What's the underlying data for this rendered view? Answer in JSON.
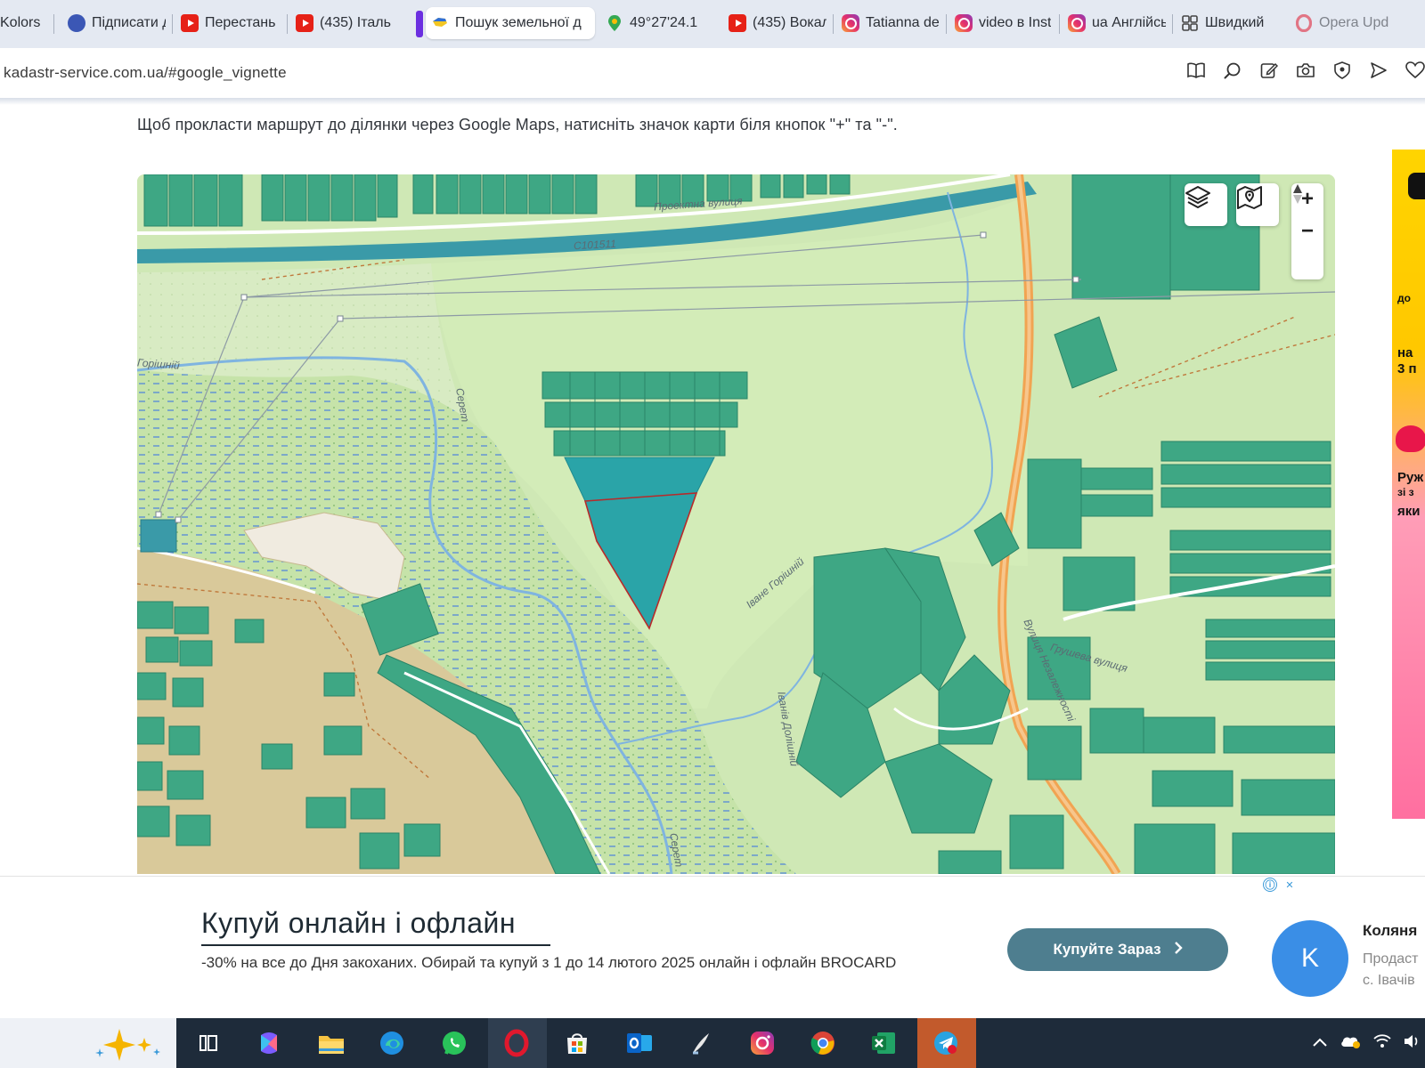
{
  "browser": {
    "tabs": [
      {
        "title": "Kolors",
        "icon": "kolors-icon"
      },
      {
        "title": "Підписати д",
        "icon": "globe-icon"
      },
      {
        "title": "Перестань",
        "icon": "youtube-icon"
      },
      {
        "title": "(435) Італь",
        "icon": "youtube-icon"
      },
      {
        "title": "Пошук земельної д",
        "icon": "ukraine-map-icon",
        "active": true
      },
      {
        "title": "49°27'24.1",
        "icon": "google-maps-pin-icon"
      },
      {
        "title": "(435) Вокал",
        "icon": "youtube-icon"
      },
      {
        "title": "Tatianna de",
        "icon": "instagram-icon"
      },
      {
        "title": "video в Inst",
        "icon": "instagram-icon"
      },
      {
        "title": "ua Англійсь",
        "icon": "instagram-icon"
      },
      {
        "title": "Швидкий",
        "icon": "speed-dial-icon"
      },
      {
        "title": "Opera Upd",
        "icon": "opera-icon"
      }
    ],
    "url": "kadastr-service.com.ua/#google_vignette",
    "toolbar_icons": [
      "reader-icon",
      "search-icon",
      "edit-icon",
      "camera-icon",
      "shield-icon",
      "send-icon",
      "heart-icon"
    ]
  },
  "page": {
    "instruction": "Щоб прокласти маршрут до ділянки через Google Maps, натисніть значок карти біля кнопок \"+\" та \"-\"."
  },
  "map": {
    "controls": {
      "layers": "layers-icon",
      "maps_route": "map-route-icon",
      "zoom_in": "+",
      "zoom_out": "−",
      "compass": "compass-icon"
    },
    "labels": {
      "street_top": "Проектна вулиця",
      "road_code": "С101511",
      "village": "Горішній",
      "river": "Серет",
      "upper_road": "Іване Горішній",
      "lower_road": "Іванів Долішній",
      "main_street": "Вулиця Незалежності",
      "side_street": "Грушева вулиця",
      "river_bottom": "Серет"
    },
    "colors": {
      "parcel": "#3ea784",
      "selected_parcel": "#2aa4a8",
      "selected_outline": "#b82a2a",
      "main_road": "#f1a452",
      "river": "#7fb4e0"
    }
  },
  "side_ad": {
    "texts": [
      "до",
      "на",
      "3 п",
      "Руж",
      "зі з",
      "яки"
    ]
  },
  "bottom_ad": {
    "title": "Купуй онлайн і офлайн",
    "description": "-30% на все до Дня закоханих. Обирай та купуй з 1 до 14 лютого 2025 онлайн і офлайн BROCARD",
    "cta": "Купуйте Зараз",
    "info_icon": "ⓘ",
    "close_icon": "✕"
  },
  "contact": {
    "initial": "K",
    "name": "Коляня",
    "line1": "Продаст",
    "line2": "с. Івачів"
  },
  "taskbar": {
    "apps": [
      "copilot-icon",
      "task-view-icon",
      "microsoft-365-icon",
      "file-explorer-icon",
      "edge-icon",
      "whatsapp-icon",
      "opera-icon",
      "store-icon",
      "outlook-icon",
      "libreoffice-icon",
      "instagram-icon",
      "chrome-icon",
      "excel-icon",
      "telegram-icon"
    ],
    "tray": [
      "chevron-up-icon",
      "onedrive-icon",
      "wifi-icon",
      "volume-icon"
    ]
  }
}
